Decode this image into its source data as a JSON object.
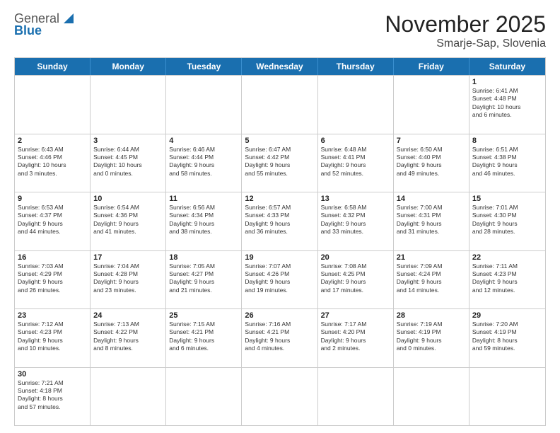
{
  "header": {
    "logo": {
      "text_general": "General",
      "text_blue": "Blue"
    },
    "title": "November 2025",
    "location": "Smarje-Sap, Slovenia"
  },
  "weekdays": [
    "Sunday",
    "Monday",
    "Tuesday",
    "Wednesday",
    "Thursday",
    "Friday",
    "Saturday"
  ],
  "weeks": [
    [
      {
        "day": "",
        "info": ""
      },
      {
        "day": "",
        "info": ""
      },
      {
        "day": "",
        "info": ""
      },
      {
        "day": "",
        "info": ""
      },
      {
        "day": "",
        "info": ""
      },
      {
        "day": "",
        "info": ""
      },
      {
        "day": "1",
        "info": "Sunrise: 6:41 AM\nSunset: 4:48 PM\nDaylight: 10 hours\nand 6 minutes."
      }
    ],
    [
      {
        "day": "2",
        "info": "Sunrise: 6:43 AM\nSunset: 4:46 PM\nDaylight: 10 hours\nand 3 minutes."
      },
      {
        "day": "3",
        "info": "Sunrise: 6:44 AM\nSunset: 4:45 PM\nDaylight: 10 hours\nand 0 minutes."
      },
      {
        "day": "4",
        "info": "Sunrise: 6:46 AM\nSunset: 4:44 PM\nDaylight: 9 hours\nand 58 minutes."
      },
      {
        "day": "5",
        "info": "Sunrise: 6:47 AM\nSunset: 4:42 PM\nDaylight: 9 hours\nand 55 minutes."
      },
      {
        "day": "6",
        "info": "Sunrise: 6:48 AM\nSunset: 4:41 PM\nDaylight: 9 hours\nand 52 minutes."
      },
      {
        "day": "7",
        "info": "Sunrise: 6:50 AM\nSunset: 4:40 PM\nDaylight: 9 hours\nand 49 minutes."
      },
      {
        "day": "8",
        "info": "Sunrise: 6:51 AM\nSunset: 4:38 PM\nDaylight: 9 hours\nand 46 minutes."
      }
    ],
    [
      {
        "day": "9",
        "info": "Sunrise: 6:53 AM\nSunset: 4:37 PM\nDaylight: 9 hours\nand 44 minutes."
      },
      {
        "day": "10",
        "info": "Sunrise: 6:54 AM\nSunset: 4:36 PM\nDaylight: 9 hours\nand 41 minutes."
      },
      {
        "day": "11",
        "info": "Sunrise: 6:56 AM\nSunset: 4:34 PM\nDaylight: 9 hours\nand 38 minutes."
      },
      {
        "day": "12",
        "info": "Sunrise: 6:57 AM\nSunset: 4:33 PM\nDaylight: 9 hours\nand 36 minutes."
      },
      {
        "day": "13",
        "info": "Sunrise: 6:58 AM\nSunset: 4:32 PM\nDaylight: 9 hours\nand 33 minutes."
      },
      {
        "day": "14",
        "info": "Sunrise: 7:00 AM\nSunset: 4:31 PM\nDaylight: 9 hours\nand 31 minutes."
      },
      {
        "day": "15",
        "info": "Sunrise: 7:01 AM\nSunset: 4:30 PM\nDaylight: 9 hours\nand 28 minutes."
      }
    ],
    [
      {
        "day": "16",
        "info": "Sunrise: 7:03 AM\nSunset: 4:29 PM\nDaylight: 9 hours\nand 26 minutes."
      },
      {
        "day": "17",
        "info": "Sunrise: 7:04 AM\nSunset: 4:28 PM\nDaylight: 9 hours\nand 23 minutes."
      },
      {
        "day": "18",
        "info": "Sunrise: 7:05 AM\nSunset: 4:27 PM\nDaylight: 9 hours\nand 21 minutes."
      },
      {
        "day": "19",
        "info": "Sunrise: 7:07 AM\nSunset: 4:26 PM\nDaylight: 9 hours\nand 19 minutes."
      },
      {
        "day": "20",
        "info": "Sunrise: 7:08 AM\nSunset: 4:25 PM\nDaylight: 9 hours\nand 17 minutes."
      },
      {
        "day": "21",
        "info": "Sunrise: 7:09 AM\nSunset: 4:24 PM\nDaylight: 9 hours\nand 14 minutes."
      },
      {
        "day": "22",
        "info": "Sunrise: 7:11 AM\nSunset: 4:23 PM\nDaylight: 9 hours\nand 12 minutes."
      }
    ],
    [
      {
        "day": "23",
        "info": "Sunrise: 7:12 AM\nSunset: 4:23 PM\nDaylight: 9 hours\nand 10 minutes."
      },
      {
        "day": "24",
        "info": "Sunrise: 7:13 AM\nSunset: 4:22 PM\nDaylight: 9 hours\nand 8 minutes."
      },
      {
        "day": "25",
        "info": "Sunrise: 7:15 AM\nSunset: 4:21 PM\nDaylight: 9 hours\nand 6 minutes."
      },
      {
        "day": "26",
        "info": "Sunrise: 7:16 AM\nSunset: 4:21 PM\nDaylight: 9 hours\nand 4 minutes."
      },
      {
        "day": "27",
        "info": "Sunrise: 7:17 AM\nSunset: 4:20 PM\nDaylight: 9 hours\nand 2 minutes."
      },
      {
        "day": "28",
        "info": "Sunrise: 7:19 AM\nSunset: 4:19 PM\nDaylight: 9 hours\nand 0 minutes."
      },
      {
        "day": "29",
        "info": "Sunrise: 7:20 AM\nSunset: 4:19 PM\nDaylight: 8 hours\nand 59 minutes."
      }
    ],
    [
      {
        "day": "30",
        "info": "Sunrise: 7:21 AM\nSunset: 4:18 PM\nDaylight: 8 hours\nand 57 minutes."
      },
      {
        "day": "",
        "info": ""
      },
      {
        "day": "",
        "info": ""
      },
      {
        "day": "",
        "info": ""
      },
      {
        "day": "",
        "info": ""
      },
      {
        "day": "",
        "info": ""
      },
      {
        "day": "",
        "info": ""
      }
    ]
  ]
}
